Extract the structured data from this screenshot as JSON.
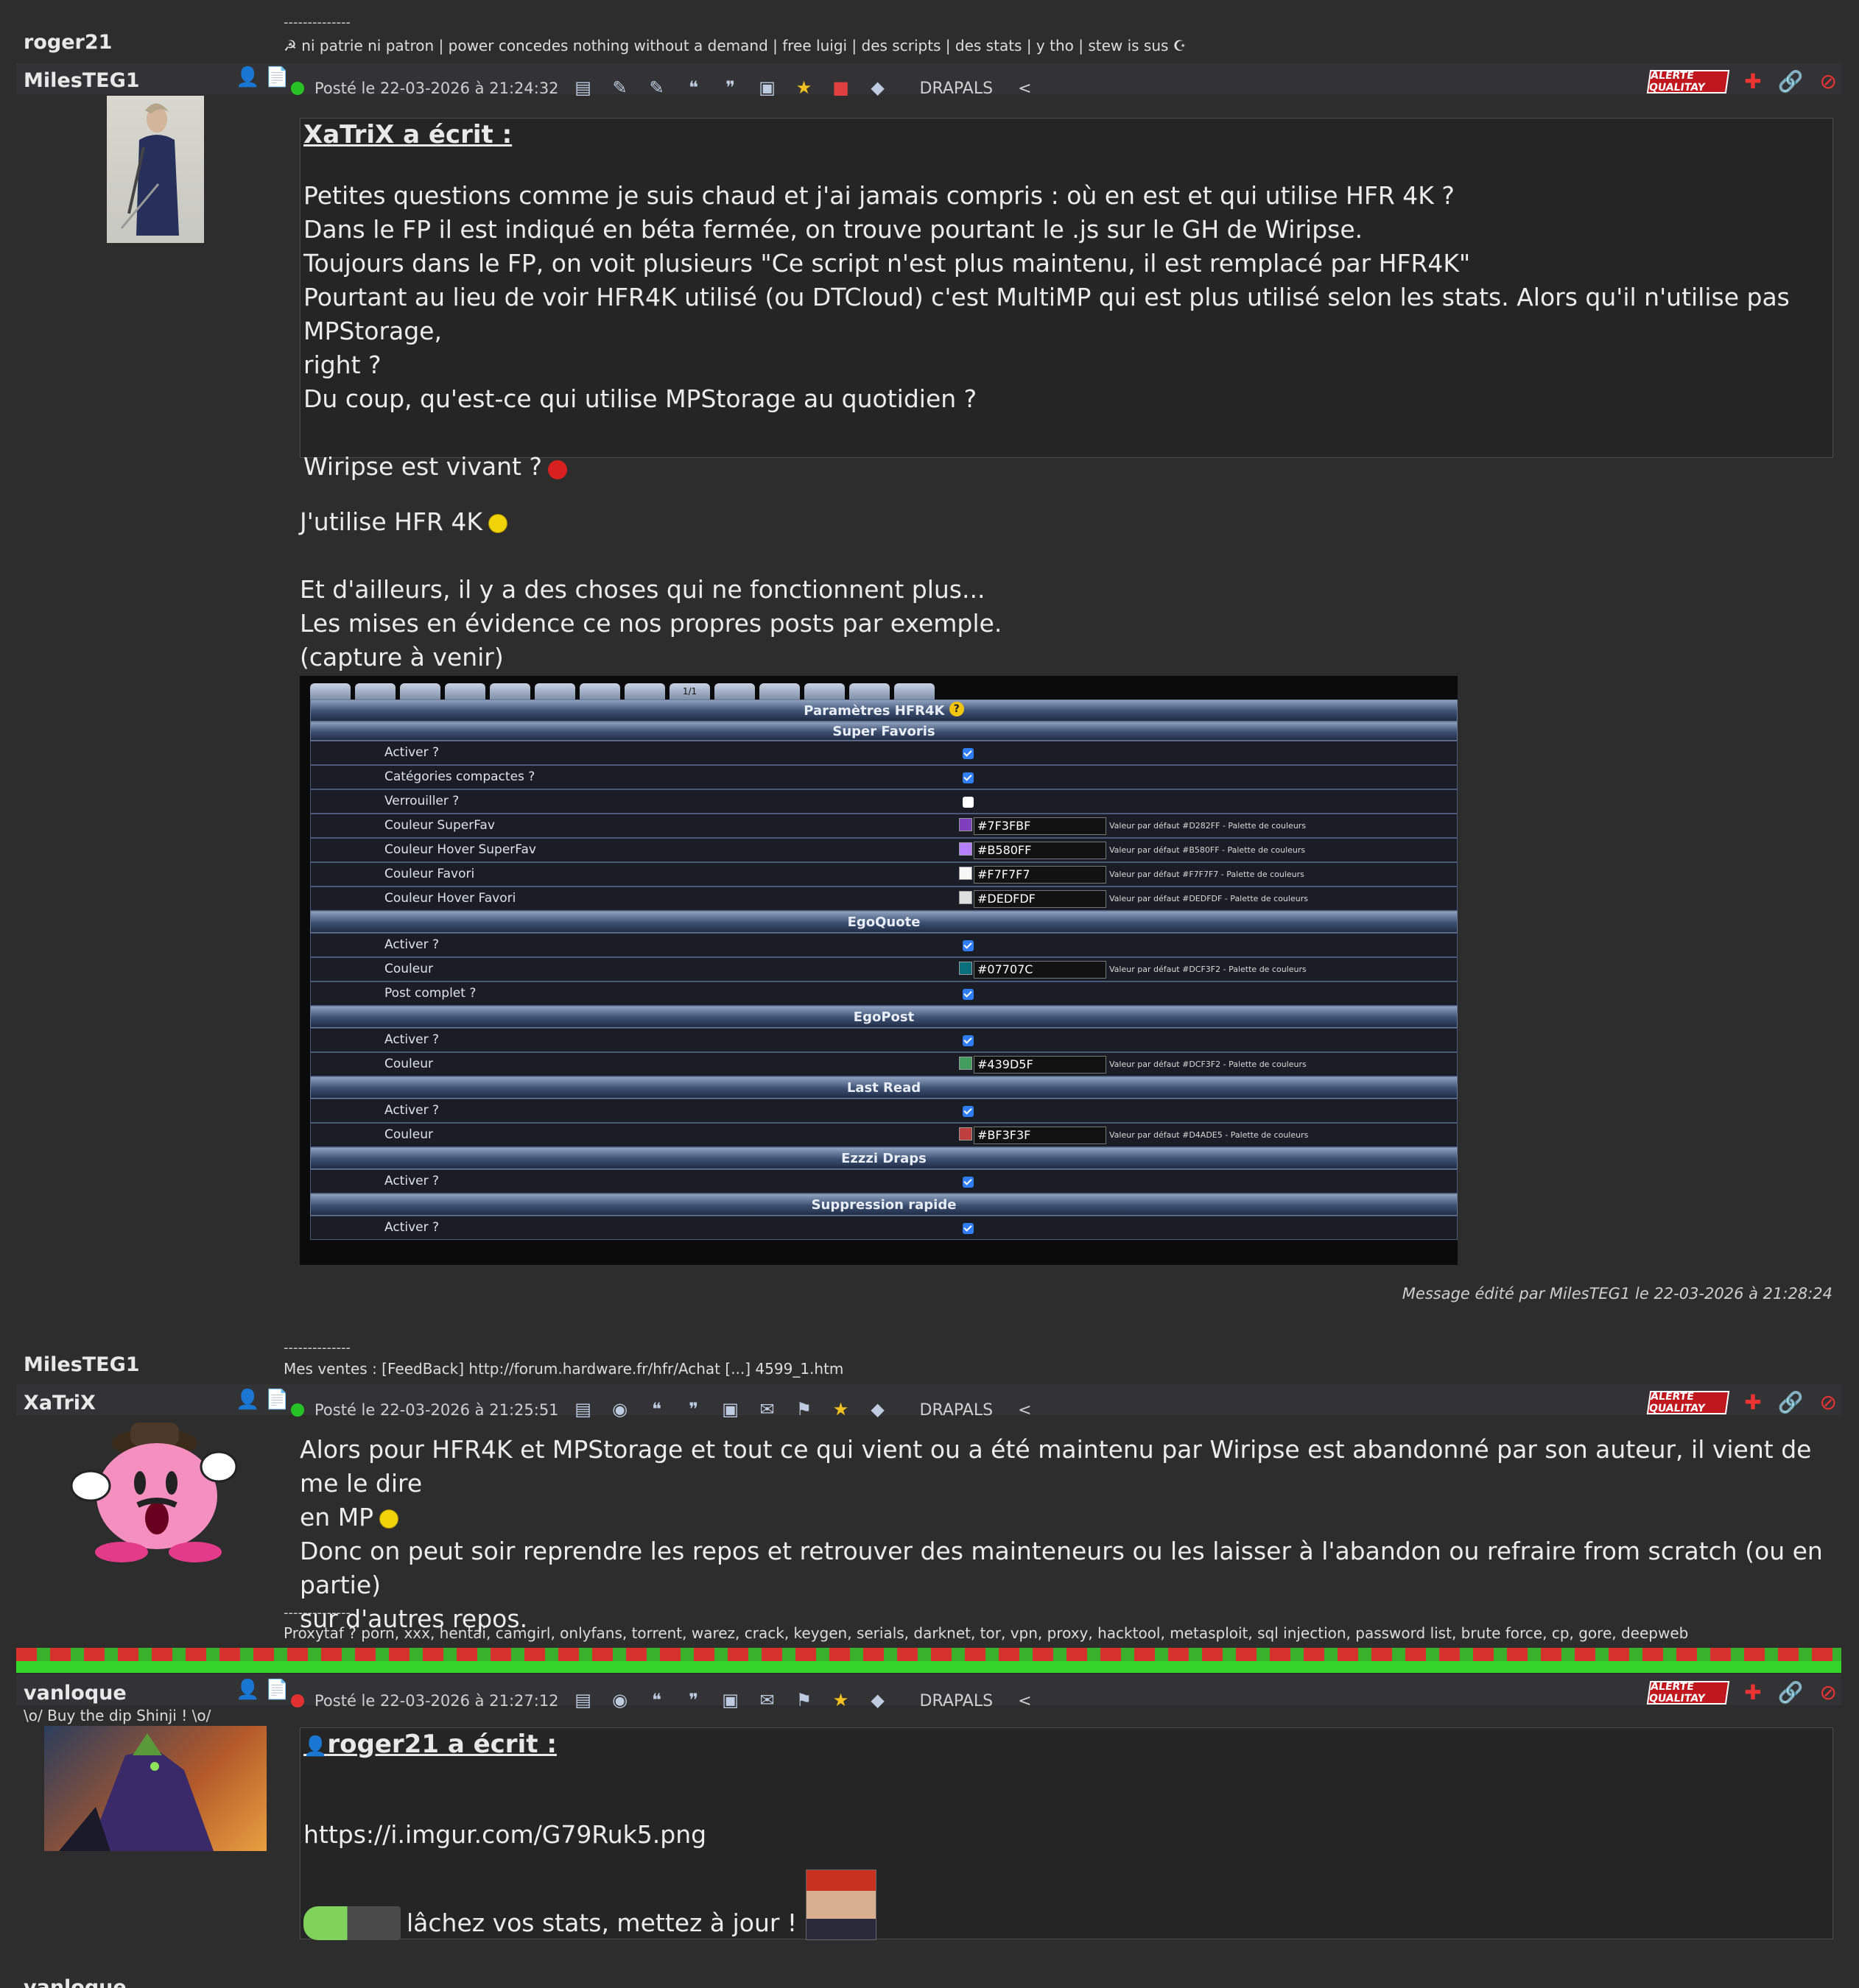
{
  "post0": {
    "sig_sep": "--------------",
    "author": "roger21",
    "sig": "☭ ni patrie ni patron | power concedes nothing without a demand | free luigi | des scripts | des stats | y tho | stew is sus ☪"
  },
  "post1": {
    "author": "MilesTEG1",
    "posted": "Posté le 22-03-2026 à 21:24:32",
    "drapals": "DRAPALS",
    "lt": "<",
    "quote_title": "XaTriX a écrit :",
    "quote_lines": [
      "Petites questions comme je suis chaud et j'ai jamais compris : où en est et qui utilise HFR 4K ?",
      "Dans le FP il est indiqué en béta fermée, on trouve pourtant le .js sur le GH de Wiripse.",
      "Toujours dans le FP, on voit plusieurs \"Ce script n'est plus maintenu, il est remplacé par HFR4K\"",
      "Pourtant au lieu de voir HFR4K utilisé (ou DTCloud) c'est MultiMP qui est plus utilisé selon les stats. Alors qu'il n'utilise pas MPStorage,",
      "right ?",
      "Du coup, qu'est-ce qui utilise MPStorage au quotidien ?",
      "Wiripse est vivant ?"
    ],
    "body_line1": "J'utilise HFR 4K",
    "body_lines": [
      "Et d'ailleurs, il y a des choses qui ne fonctionnent plus...",
      "Les mises en évidence ce nos propres posts par exemple.",
      "(capture à venir)"
    ],
    "edited": "Message édité par MilesTEG1 le 22-03-2026 à 21:28:24",
    "sig_sep": "--------------",
    "sig_author": "MilesTEG1",
    "sig": "Mes ventes : [FeedBack] http://forum.hardware.fr/hfr/Achat [...] 4599_1.htm"
  },
  "screenshot": {
    "tab_labels": [
      "",
      "",
      "",
      "",
      "",
      "",
      "",
      "",
      "1/1",
      "",
      "",
      "",
      "",
      ""
    ],
    "title": "Paramètres HFR4K",
    "sections": [
      {
        "name": "Super Favoris",
        "rows": [
          {
            "label": "Activer ?",
            "checked": true
          },
          {
            "label": "Catégories compactes ?",
            "checked": true
          },
          {
            "label": "Verrouiller ?",
            "checked": false
          },
          {
            "label": "Couleur SuperFav",
            "color": "#7F3FBF",
            "default": "Valeur par défaut #D282FF - Palette de couleurs"
          },
          {
            "label": "Couleur Hover SuperFav",
            "color": "#B580FF",
            "default": "Valeur par défaut #B580FF - Palette de couleurs"
          },
          {
            "label": "Couleur Favori",
            "color": "#F7F7F7",
            "default": "Valeur par défaut #F7F7F7 - Palette de couleurs"
          },
          {
            "label": "Couleur Hover Favori",
            "color": "#DEDFDF",
            "default": "Valeur par défaut #DEDFDF - Palette de couleurs"
          }
        ]
      },
      {
        "name": "EgoQuote",
        "rows": [
          {
            "label": "Activer ?",
            "checked": true
          },
          {
            "label": "Couleur",
            "color": "#07707C",
            "default": "Valeur par défaut #DCF3F2 - Palette de couleurs"
          },
          {
            "label": "Post complet ?",
            "checked": true
          }
        ]
      },
      {
        "name": "EgoPost",
        "rows": [
          {
            "label": "Activer ?",
            "checked": true
          },
          {
            "label": "Couleur",
            "color": "#439D5F",
            "default": "Valeur par défaut #DCF3F2 - Palette de couleurs"
          }
        ]
      },
      {
        "name": "Last Read",
        "rows": [
          {
            "label": "Activer ?",
            "checked": true
          },
          {
            "label": "Couleur",
            "color": "#BF3F3F",
            "default": "Valeur par défaut #D4ADE5 - Palette de couleurs"
          }
        ]
      },
      {
        "name": "Ezzzi Draps",
        "rows": [
          {
            "label": "Activer ?",
            "checked": true
          }
        ]
      },
      {
        "name": "Suppression rapide",
        "rows": [
          {
            "label": "Activer ?",
            "checked": true
          }
        ]
      }
    ]
  },
  "post2": {
    "author": "XaTriX",
    "posted": "Posté le 22-03-2026 à 21:25:51",
    "drapals": "DRAPALS",
    "lt": "<",
    "line1": "Alors pour HFR4K et MPStorage et tout ce qui vient ou a été maintenu par Wiripse est abandonné par son auteur, il vient de me le dire",
    "line2": "en MP",
    "line3": "Donc on peut soir reprendre les repos et retrouver des mainteneurs ou les laisser à l'abandon ou refraire from scratch (ou en partie)",
    "line4": "sur d'autres repos.",
    "sig_sep": "--------------",
    "sig": "Proxytaf ? porn, xxx, hentai, camgirl, onlyfans, torrent, warez, crack, keygen, serials, darknet, tor, vpn, proxy, hacktool, metasploit, sql injection, password list, brute force, cp, gore, deepweb"
  },
  "post3": {
    "author": "vanloque",
    "subtitle": "\\o/ Buy the dip Shinji ! \\o/",
    "posted": "Posté le 22-03-2026 à 21:27:12",
    "drapals": "DRAPALS",
    "lt": "<",
    "quote_title": "roger21 a écrit :",
    "quote_link": "https://i.imgur.com/G79Ruk5.png",
    "quote_text": "lâchez vos stats, mettez à jour !",
    "next_author": "vanloque"
  },
  "alerte": "ALERTE QUALITAY",
  "colors": {
    "bg": "#2d2d2e",
    "row": "#333335",
    "quote_bg": "#252526",
    "online": "#26c226",
    "offline": "#e03030",
    "stripe_red": "#d7322e",
    "stripe_green": "#35d52a"
  }
}
